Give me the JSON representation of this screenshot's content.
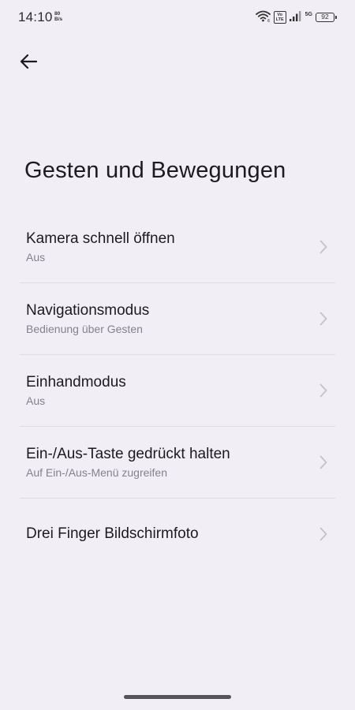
{
  "status_bar": {
    "time": "14:10",
    "net_speed_value": "80",
    "net_speed_unit": "B/s",
    "volte_line1": "Vo",
    "volte_line2": "LTE",
    "network_type": "5G",
    "battery_level": "92",
    "icons": [
      "wifi-icon",
      "volte-icon",
      "signal-icon",
      "battery-icon"
    ]
  },
  "header": {
    "back_icon": "arrow-left-icon",
    "title": "Gesten und Bewegungen"
  },
  "settings": {
    "items": [
      {
        "title": "Kamera schnell öffnen",
        "subtitle": "Aus"
      },
      {
        "title": "Navigationsmodus",
        "subtitle": "Bedienung über Gesten"
      },
      {
        "title": "Einhandmodus",
        "subtitle": "Aus"
      },
      {
        "title": "Ein-/Aus-Taste gedrückt halten",
        "subtitle": "Auf Ein-/Aus-Menü zugreifen"
      },
      {
        "title": "Drei Finger Bildschirmfoto"
      }
    ]
  },
  "colors": {
    "background": "#f1eff5",
    "text_primary": "#1d1b20",
    "text_secondary": "#85818c",
    "divider": "#dedbe2",
    "chevron": "#c4c1c8"
  }
}
